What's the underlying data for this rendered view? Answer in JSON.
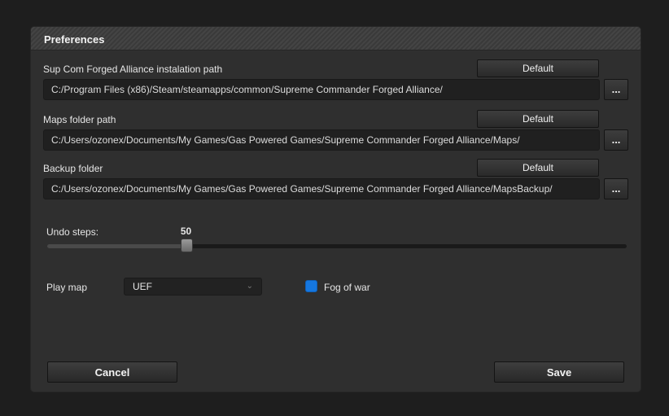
{
  "dialog": {
    "title": "Preferences"
  },
  "game_path": {
    "label": "Sup Com Forged Alliance instalation path",
    "default_label": "Default",
    "value": "C:/Program Files (x86)/Steam/steamapps/common/Supreme Commander Forged Alliance/",
    "browse_label": "..."
  },
  "maps_path": {
    "label": "Maps folder path",
    "default_label": "Default",
    "value": "C:/Users/ozonex/Documents/My Games/Gas Powered Games/Supreme Commander Forged Alliance/Maps/",
    "browse_label": "..."
  },
  "backup_path": {
    "label": "Backup folder",
    "default_label": "Default",
    "value": "C:/Users/ozonex/Documents/My Games/Gas Powered Games/Supreme Commander Forged Alliance/MapsBackup/",
    "browse_label": "..."
  },
  "undo": {
    "label": "Undo steps:",
    "value": "50",
    "fraction": 0.24
  },
  "play_map": {
    "label": "Play map",
    "selected": "UEF"
  },
  "fog_of_war": {
    "label": "Fog of war",
    "checked": true,
    "color": "#1577e0"
  },
  "footer": {
    "cancel_label": "Cancel",
    "save_label": "Save"
  }
}
